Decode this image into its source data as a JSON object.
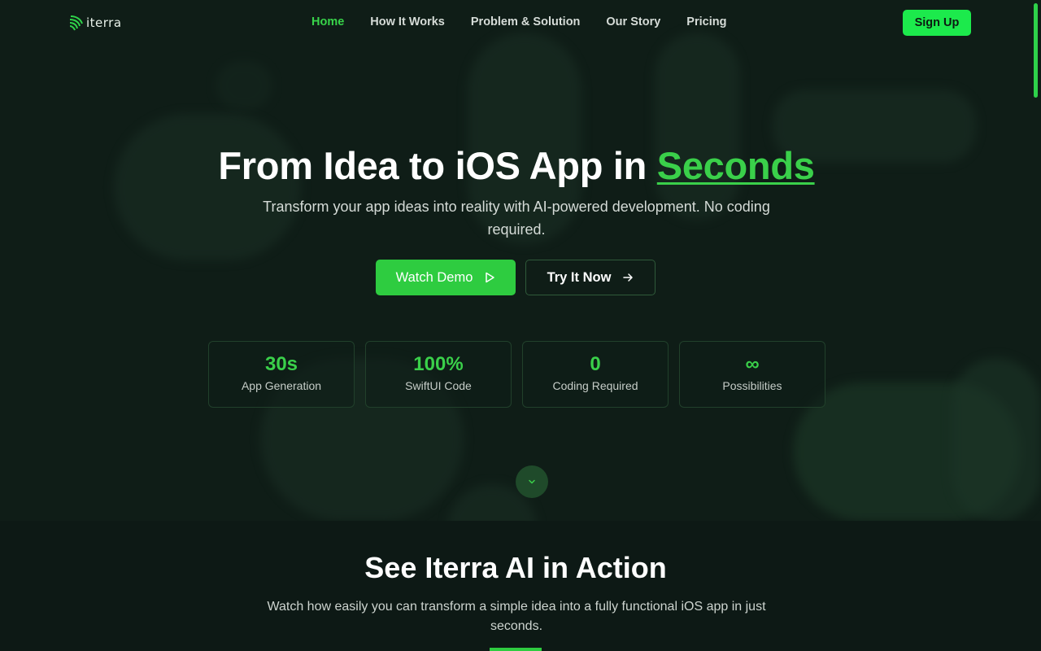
{
  "brand": {
    "name": "iterra",
    "accent": "#3ad04a",
    "button_green": "#1cea4c"
  },
  "nav": {
    "links": [
      {
        "label": "Home",
        "active": true
      },
      {
        "label": "How It Works",
        "active": false
      },
      {
        "label": "Problem & Solution",
        "active": false
      },
      {
        "label": "Our Story",
        "active": false
      },
      {
        "label": "Pricing",
        "active": false
      }
    ],
    "signup_label": "Sign Up"
  },
  "hero": {
    "title_prefix": "From Idea to iOS App in ",
    "title_accent": "Seconds",
    "subtitle": "Transform your app ideas into reality with AI-powered development. No coding required.",
    "primary_button": {
      "label": "Watch Demo",
      "icon": "play-icon"
    },
    "secondary_button": {
      "label": "Try It Now",
      "icon": "arrow-right-icon"
    }
  },
  "stats": [
    {
      "value": "30s",
      "label": "App Generation"
    },
    {
      "value": "100%",
      "label": "SwiftUI Code"
    },
    {
      "value": "0",
      "label": "Coding Required"
    },
    {
      "value": "∞",
      "label": "Possibilities"
    }
  ],
  "scroll_indicator": {
    "icon": "chevron-down-icon"
  },
  "demo_section": {
    "title": "See Iterra AI in Action",
    "subtitle": "Watch how easily you can transform a simple idea into a fully functional iOS app in just seconds."
  }
}
